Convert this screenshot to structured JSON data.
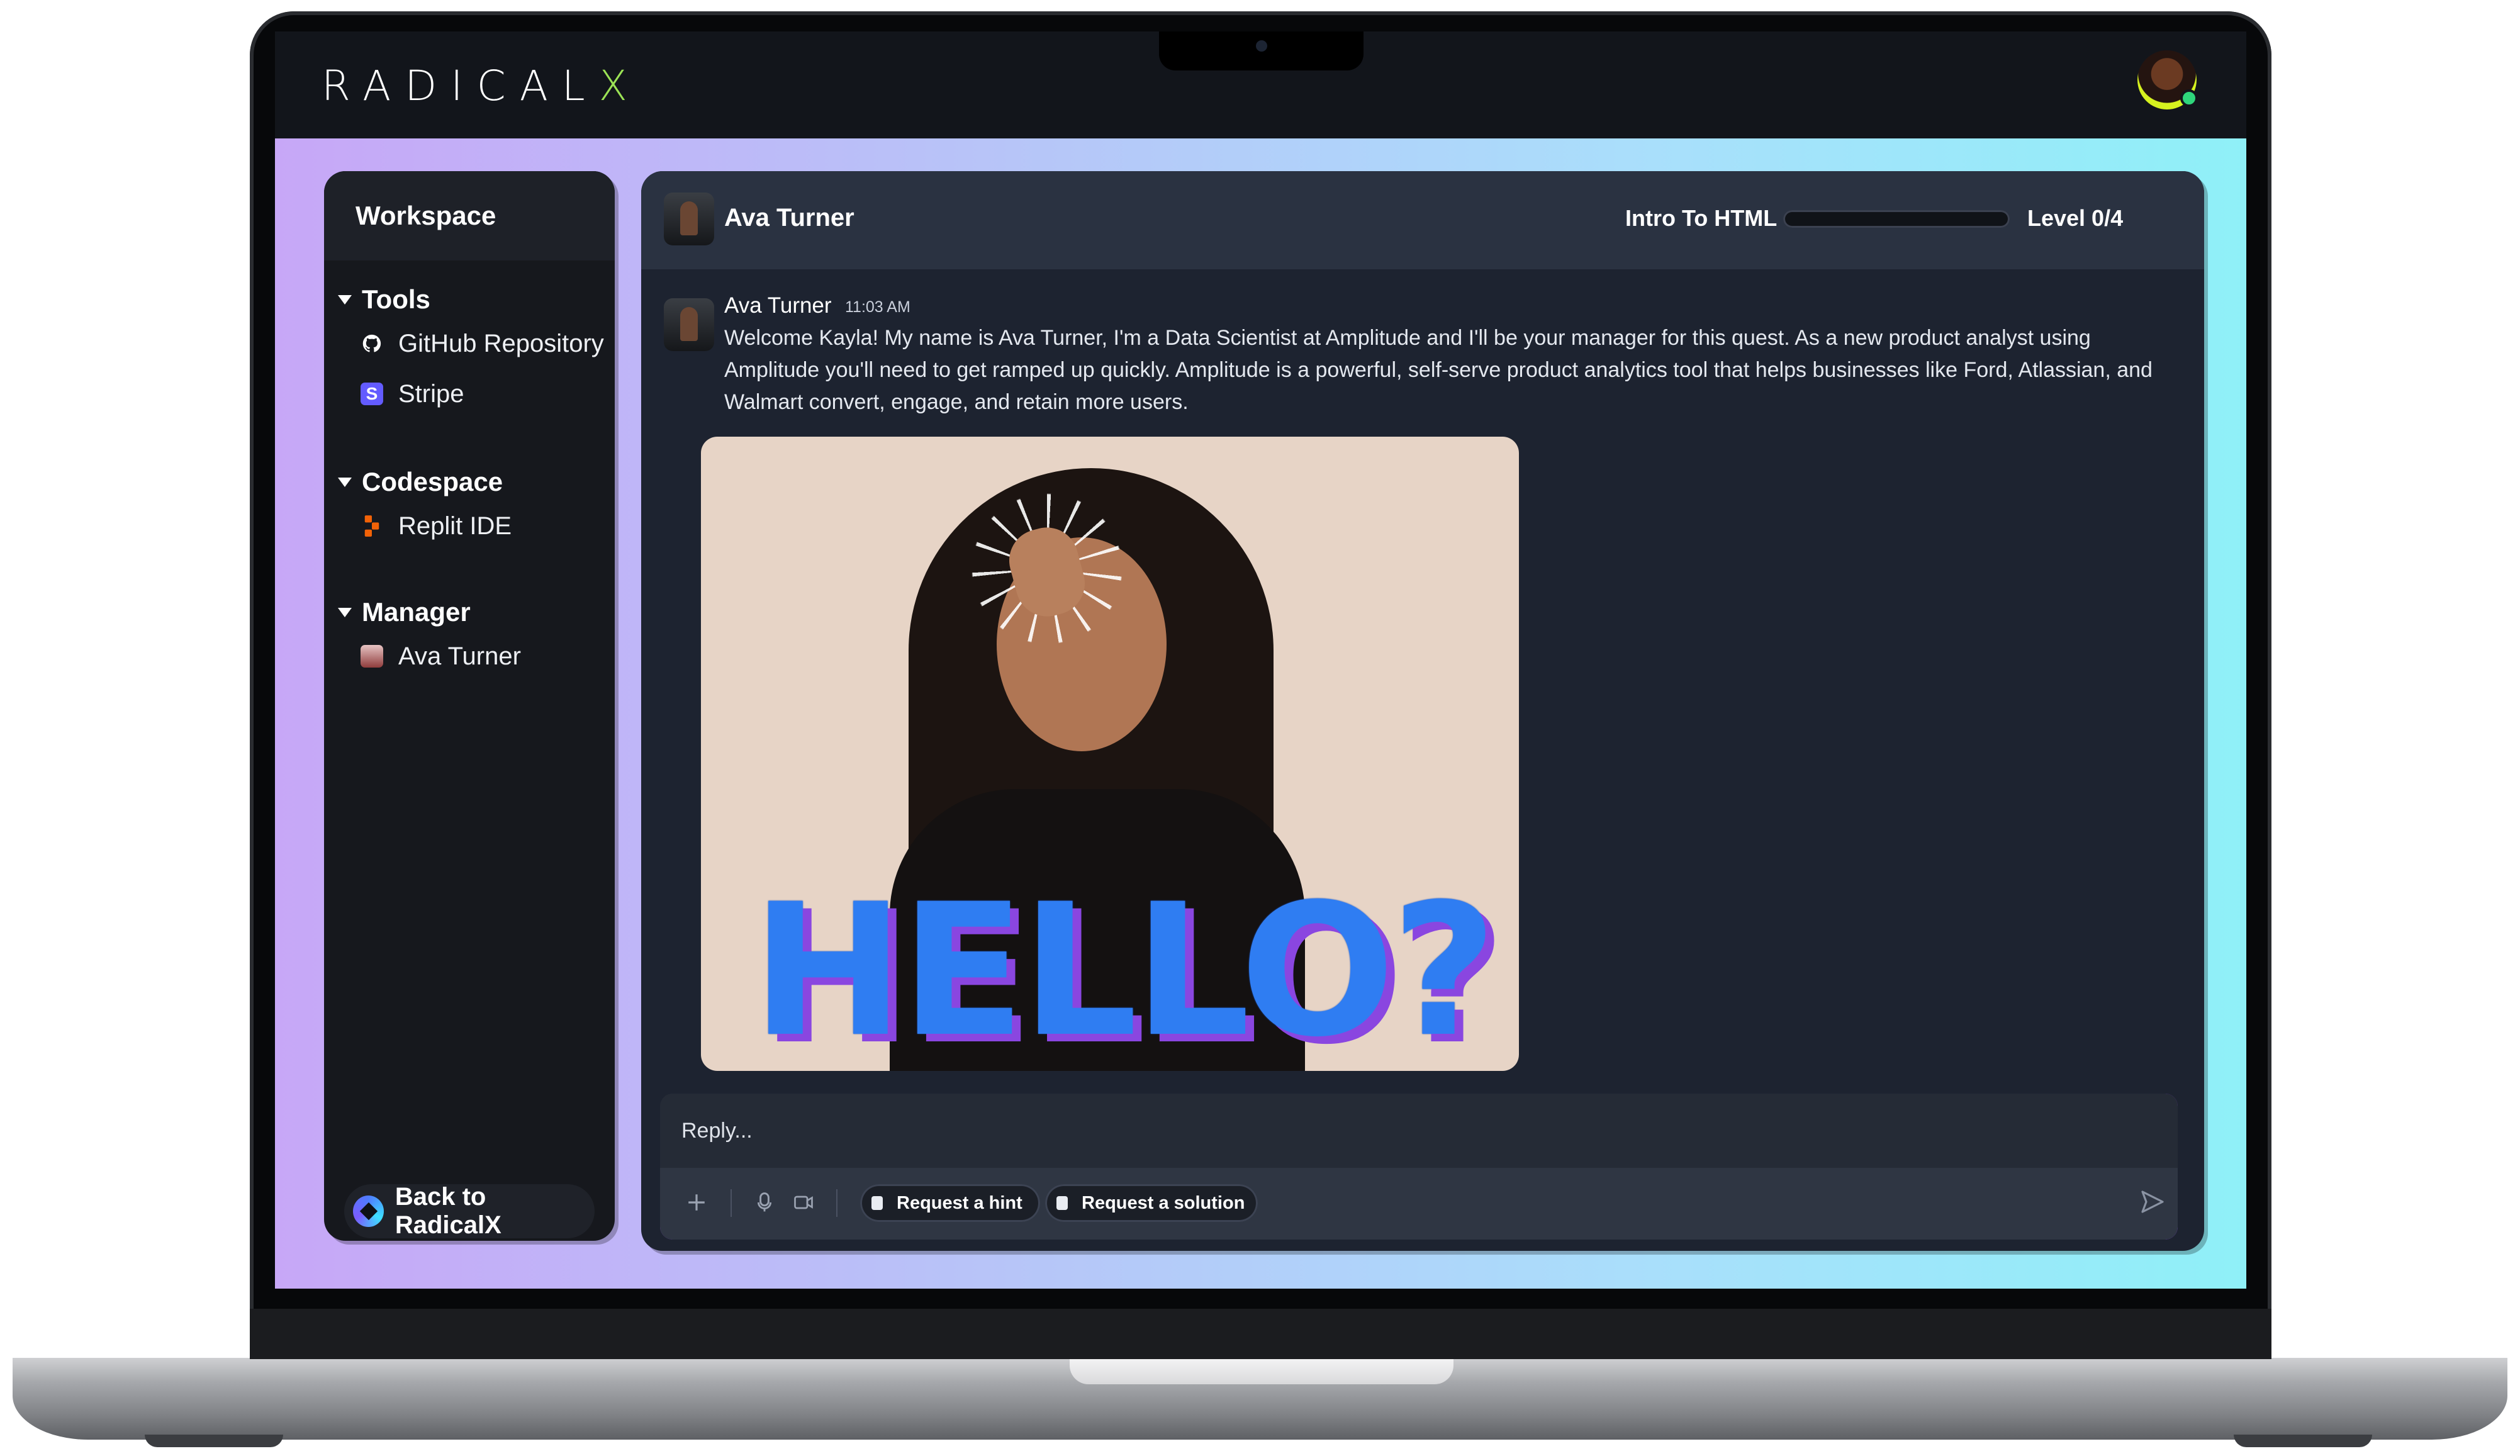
{
  "app": {
    "brand_main": "RADICAL",
    "brand_accent": "X",
    "accent_color": "#9be255"
  },
  "sidebar": {
    "title": "Workspace",
    "groups": [
      {
        "label": "Tools",
        "items": [
          {
            "label": "GitHub Repository",
            "icon": "github-icon"
          },
          {
            "label": "Stripe",
            "icon": "stripe-icon"
          }
        ]
      },
      {
        "label": "Codespace",
        "items": [
          {
            "label": "Replit IDE",
            "icon": "replit-icon"
          }
        ]
      },
      {
        "label": "Manager",
        "items": [
          {
            "label": "Ava Turner",
            "icon": "avatar-icon"
          }
        ]
      }
    ],
    "back_button": "Back to RadicalX"
  },
  "chat": {
    "header": {
      "name": "Ava Turner",
      "course": "Intro To HTML",
      "level": "Level 0/4",
      "progress": 0
    },
    "message": {
      "author": "Ava Turner",
      "time": "11:03 AM",
      "text": "Welcome Kayla! My name is Ava Turner, I'm a Data Scientist at Amplitude and I'll be your manager for this quest. As a new product analyst using Amplitude you'll need to get ramped up quickly. Amplitude is a powerful, self-serve product analytics tool that helps businesses like Ford, Atlassian, and Walmart convert, engage, and retain more users.",
      "gif_caption": "HELLO?"
    },
    "reply": {
      "placeholder": "Reply...",
      "hint_button": "Request a hint",
      "solution_button": "Request a solution"
    }
  }
}
